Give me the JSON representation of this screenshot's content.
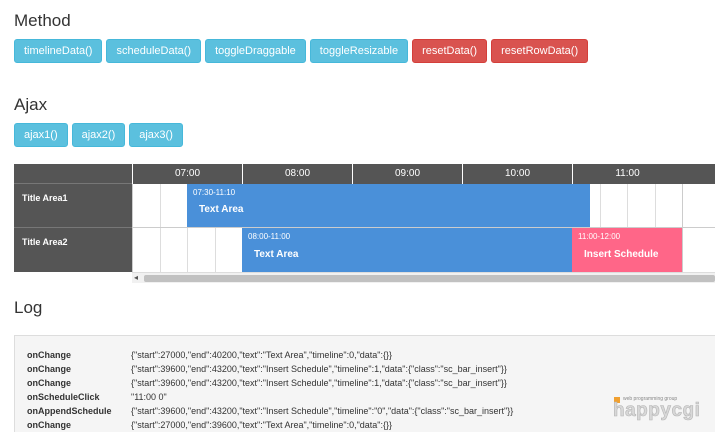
{
  "method": {
    "title": "Method",
    "buttons": [
      {
        "label": "timelineData()",
        "style": "info"
      },
      {
        "label": "scheduleData()",
        "style": "info"
      },
      {
        "label": "toggleDraggable",
        "style": "info"
      },
      {
        "label": "toggleResizable",
        "style": "info"
      },
      {
        "label": "resetData()",
        "style": "danger"
      },
      {
        "label": "resetRowData()",
        "style": "danger"
      }
    ]
  },
  "ajax": {
    "title": "Ajax",
    "buttons": [
      {
        "label": "ajax1()"
      },
      {
        "label": "ajax2()"
      },
      {
        "label": "ajax3()"
      }
    ]
  },
  "schedule": {
    "hours": [
      "07:00",
      "08:00",
      "09:00",
      "10:00",
      "11:00"
    ],
    "rows": [
      {
        "title": "Title Area1"
      },
      {
        "title": "Title Area2"
      }
    ],
    "bars": [
      {
        "row": 0,
        "start": "07:30",
        "end": "11:10",
        "time_label": "07:30-11:10",
        "text": "Text Area",
        "color": "#4a90d9"
      },
      {
        "row": 1,
        "start": "08:00",
        "end": "11:00",
        "time_label": "08:00-11:00",
        "text": "Text Area",
        "color": "#4a90d9"
      },
      {
        "row": 1,
        "start": "11:00",
        "end": "12:00",
        "time_label": "11:00-12:00",
        "text": "Insert Schedule",
        "color": "#ff6688"
      }
    ]
  },
  "log": {
    "title": "Log",
    "entries": [
      {
        "event": "onChange",
        "detail": "{\"start\":27000,\"end\":40200,\"text\":\"Text Area\",\"timeline\":0,\"data\":{}}"
      },
      {
        "event": "onChange",
        "detail": "{\"start\":39600,\"end\":43200,\"text\":\"Insert Schedule\",\"timeline\":1,\"data\":{\"class\":\"sc_bar_insert\"}}"
      },
      {
        "event": "onChange",
        "detail": "{\"start\":39600,\"end\":43200,\"text\":\"Insert Schedule\",\"timeline\":1,\"data\":{\"class\":\"sc_bar_insert\"}}"
      },
      {
        "event": "onScheduleClick",
        "detail": "\"11:00 0\""
      },
      {
        "event": "onAppendSchedule",
        "detail": "{\"start\":39600,\"end\":43200,\"text\":\"Insert Schedule\",\"timeline\":\"0\",\"data\":{\"class\":\"sc_bar_insert\"}}"
      },
      {
        "event": "onChange",
        "detail": "{\"start\":27000,\"end\":39600,\"text\":\"Text Area\",\"timeline\":0,\"data\":{}}"
      }
    ]
  },
  "logo": {
    "tagline": "web programming group",
    "word": "happycgi"
  }
}
